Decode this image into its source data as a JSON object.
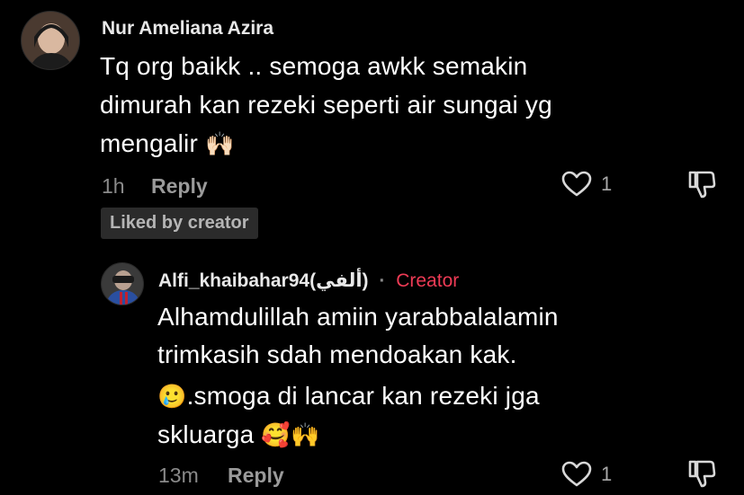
{
  "comment": {
    "username": "Nur Ameliana Azira",
    "lines": [
      "Tq org baikk .. semoga awkk semakin",
      "dimurah kan rezeki seperti air sungai yg",
      "mengalir"
    ],
    "emoji": "🙌🏻",
    "time": "1h",
    "reply_label": "Reply",
    "like_count": "1",
    "liked_badge": "Liked by creator"
  },
  "reply": {
    "username": "Alfi_khaibahar94(ألفي)",
    "separator": "·",
    "creator_label": "Creator",
    "lines": [
      "Alhamdulillah amiin yarabbalalamin",
      "trimkasih sdah mendoakan kak.",
      ".smoga di lancar kan rezeki jga",
      "skluarga"
    ],
    "emoji_lead": "🥲",
    "emoji_tail": "🥰🙌",
    "time": "13m",
    "reply_label": "Reply",
    "like_count": "1"
  },
  "colors": {
    "background": "#000000",
    "creator": "#ee3b55",
    "muted": "#8a8a8a"
  }
}
